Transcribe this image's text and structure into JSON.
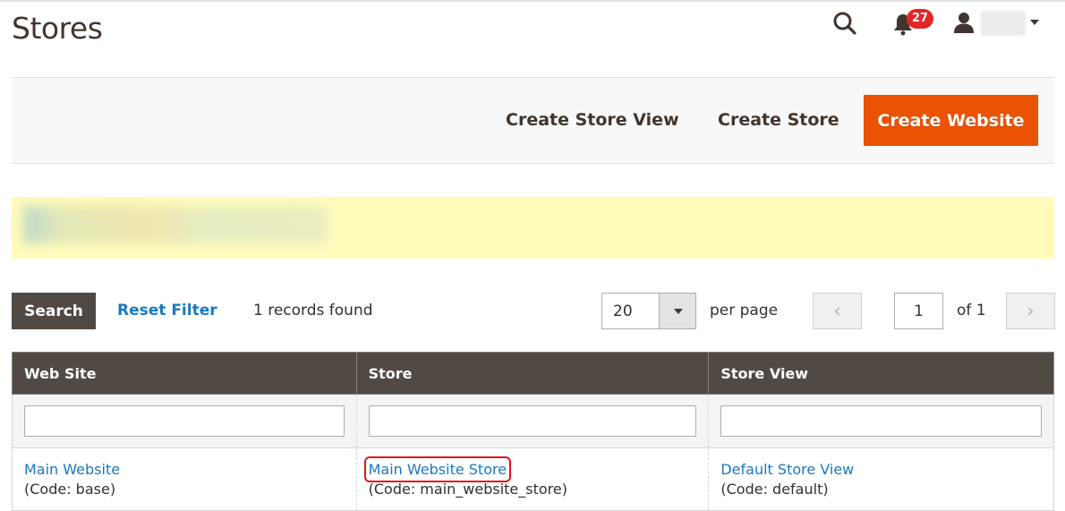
{
  "page": {
    "title": "Stores"
  },
  "header": {
    "notifications_count": "27",
    "icons": {
      "search": "search-icon",
      "notifications": "bell-icon",
      "user": "user-icon",
      "user_menu": "caret-down-icon"
    }
  },
  "actions": {
    "create_store_view": "Create Store View",
    "create_store": "Create Store",
    "create_website": "Create Website"
  },
  "colors": {
    "primary_button": "#eb5202",
    "header_bg": "#514943",
    "link": "#1979c3",
    "badge": "#e22626",
    "message_bg": "#fffbbb",
    "highlight_outline": "#e0141e"
  },
  "toolbar": {
    "search_label": "Search",
    "reset_filter_label": "Reset Filter",
    "records_found": "1 records found",
    "per_page_value": "20",
    "per_page_label": "per page",
    "prev_label": "‹",
    "next_label": "›",
    "current_page": "1",
    "total_pages_label": "of 1"
  },
  "grid": {
    "columns": [
      "Web Site",
      "Store",
      "Store View"
    ],
    "rows": [
      {
        "website": {
          "name": "Main Website",
          "code": "(Code: base)"
        },
        "store": {
          "name": "Main Website Store",
          "code": "(Code: main_website_store)"
        },
        "store_view": {
          "name": "Default Store View",
          "code": "(Code: default)"
        }
      }
    ]
  }
}
